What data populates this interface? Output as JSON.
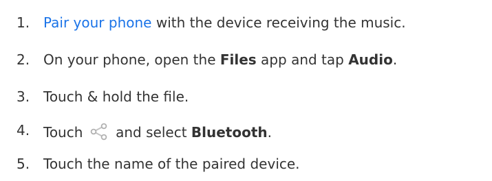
{
  "steps": [
    {
      "number": "1.",
      "link_text": "Pair your phone",
      "text_after": " with the device receiving the music."
    },
    {
      "number": "2.",
      "text_before": "On your phone, open the ",
      "bold_1": "Files",
      "text_middle": " app and tap ",
      "bold_2": "Audio",
      "text_after": "."
    },
    {
      "number": "3.",
      "text": "Touch & hold the file."
    },
    {
      "number": "4.",
      "text_before": "Touch ",
      "icon": "share-icon",
      "text_middle": " and select ",
      "bold_1": "Bluetooth",
      "text_after": "."
    },
    {
      "number": "5.",
      "text": "Touch the name of the paired device."
    }
  ],
  "colors": {
    "text": "#333333",
    "link": "#1a73e8",
    "icon": "#b0b0b0"
  }
}
